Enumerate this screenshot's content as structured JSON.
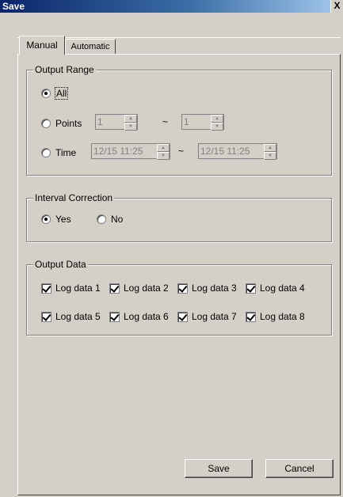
{
  "window": {
    "title": "Save",
    "close_glyph": "X"
  },
  "tabs": [
    {
      "label": "Manual"
    },
    {
      "label": "Automatic"
    }
  ],
  "output_range": {
    "legend": "Output Range",
    "all_label": "All",
    "points_label": "Points",
    "points_from": "1",
    "points_to": "1",
    "time_label": "Time",
    "time_from": "12/15 11:25",
    "time_to": "12/15 11:25",
    "tilde": "~",
    "selected": "All"
  },
  "interval_correction": {
    "legend": "Interval Correction",
    "yes_label": "Yes",
    "no_label": "No",
    "selected": "Yes"
  },
  "output_data": {
    "legend": "Output Data",
    "items": [
      {
        "label": "Log data 1",
        "checked": true
      },
      {
        "label": "Log data 2",
        "checked": true
      },
      {
        "label": "Log data 3",
        "checked": true
      },
      {
        "label": "Log data 4",
        "checked": true
      },
      {
        "label": "Log data 5",
        "checked": true
      },
      {
        "label": "Log data 6",
        "checked": true
      },
      {
        "label": "Log data 7",
        "checked": true
      },
      {
        "label": "Log data 8",
        "checked": true
      }
    ]
  },
  "buttons": {
    "save": "Save",
    "cancel": "Cancel"
  }
}
